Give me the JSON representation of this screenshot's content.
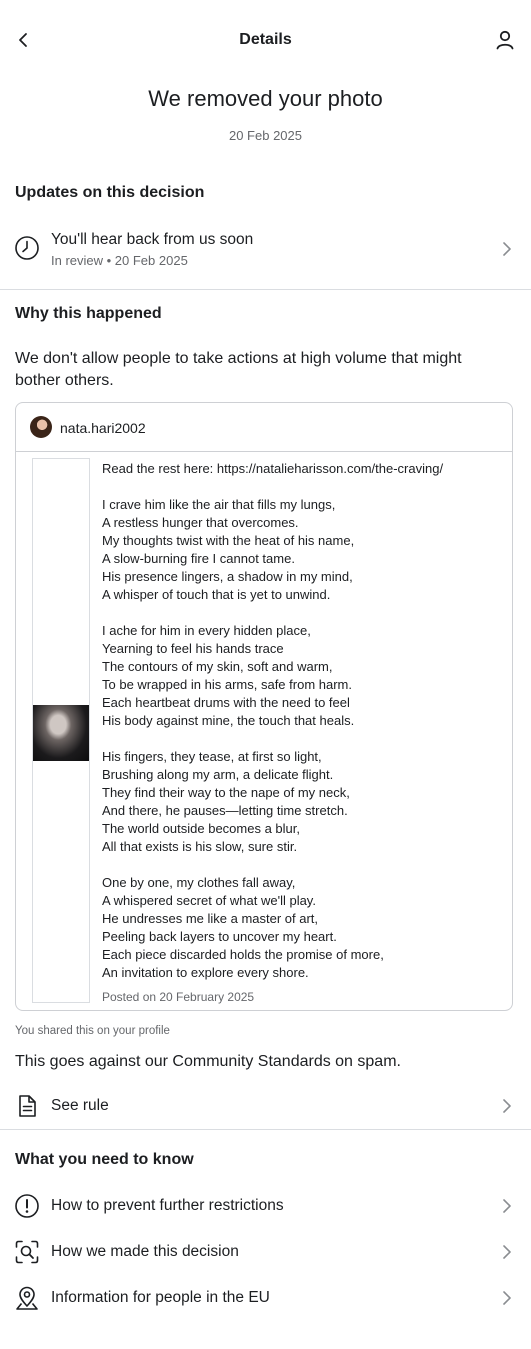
{
  "header": {
    "title": "Details"
  },
  "decision": {
    "title": "We removed your photo",
    "date": "20 Feb 2025"
  },
  "updates": {
    "heading": "Updates on this decision",
    "status_title": "You'll hear back from us soon",
    "status_sub": "In review • 20 Feb 2025"
  },
  "why": {
    "heading": "Why this happened",
    "text": "We don't allow people to take actions at high volume that might bother others."
  },
  "post": {
    "username": "nata.hari2002",
    "text": "Read the rest here: https://natalieharisson.com/the-craving/\n\nI crave him like the air that fills my lungs,\nA restless hunger that overcomes.\nMy thoughts twist with the heat of his name,\nA slow-burning fire I cannot tame.\nHis presence lingers, a shadow in my mind,\nA whisper of touch that is yet to unwind.\n\nI ache for him in every hidden place,\nYearning to feel his hands trace\nThe contours of my skin, soft and warm,\nTo be wrapped in his arms, safe from harm.\nEach heartbeat drums with the need to feel\nHis body against mine, the touch that heals.\n\nHis fingers, they tease, at first so light,\nBrushing along my arm, a delicate flight.\nThey find their way to the nape of my neck,\nAnd there, he pauses—letting time stretch.\nThe world outside becomes a blur,\nAll that exists is his slow, sure stir.\n\nOne by one, my clothes fall away,\nA whispered secret of what we'll play.\nHe undresses me like a master of art,\nPeeling back layers to uncover my heart.\nEach piece discarded holds the promise of more,\nAn invitation to explore every shore.",
    "posted": "Posted on 20 February 2025"
  },
  "shared_note": "You shared this on your profile",
  "standards_text": "This goes against our Community Standards on spam.",
  "see_rule": "See rule",
  "know": {
    "heading": "What you need to know",
    "items": [
      {
        "label": "How to prevent further restrictions",
        "icon": "exclamation-circle-icon"
      },
      {
        "label": "How we made this decision",
        "icon": "search-document-icon"
      },
      {
        "label": "Information for people in the EU",
        "icon": "location-pin-icon"
      }
    ]
  }
}
